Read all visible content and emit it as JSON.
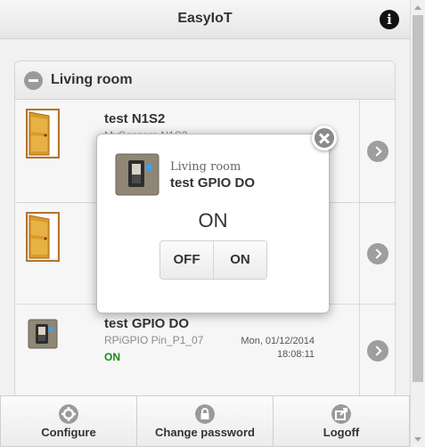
{
  "header": {
    "title": "EasyIoT",
    "info_icon": "info-icon"
  },
  "panel": {
    "title": "Living room"
  },
  "rows": [
    {
      "name": "test N1S2",
      "sub": "MySensors N1S2",
      "icon": "door-icon"
    },
    {
      "name": "",
      "sub": "",
      "icon": "door-icon"
    },
    {
      "name": "test GPIO DO",
      "sub": "RPiGPIO Pin_P1_07",
      "status": "ON",
      "date": "Mon, 01/12/2014",
      "time": "18:08:11",
      "icon": "switch-icon"
    }
  ],
  "footer": {
    "configure": "Configure",
    "change_password": "Change password",
    "logoff": "Logoff"
  },
  "popup": {
    "room": "Living room",
    "device": "test GPIO DO",
    "state": "ON",
    "off_label": "OFF",
    "on_label": "ON"
  },
  "colors": {
    "status_on": "#1a8a1a",
    "accent_gray": "#9a9a9a"
  }
}
